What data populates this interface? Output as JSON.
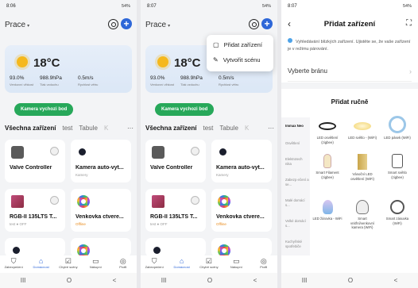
{
  "screen1": {
    "status": {
      "time": "8:06",
      "right": "54%"
    },
    "home_title": "Prace",
    "weather": {
      "temp": "18°C",
      "humidity": "93.0%",
      "humidity_label": "Venkovní vlhkost",
      "pressure": "988.9hPa",
      "pressure_label": "Tlak vzduchu",
      "wind": "0.5m/s",
      "wind_label": "Rychlost větru"
    },
    "camera_button": "Kamera vychozi bod",
    "tabs": [
      "Všechna zařízení",
      "test",
      "Tabule",
      "K"
    ],
    "more": "···",
    "devices": [
      {
        "name": "Valve Controller",
        "sub": ""
      },
      {
        "name": "Kamera auto-vyt...",
        "sub": "Kamery"
      },
      {
        "name": "RGB-II 135LTS T...",
        "sub": "test",
        "sub2": "OFF"
      },
      {
        "name": "Venkovka ctvere...",
        "sub": "Offline"
      }
    ],
    "nav": [
      "Zabezpečení",
      "Domácnost",
      "Chytré scény",
      "Nákupní",
      "Profil"
    ]
  },
  "screen2": {
    "status": {
      "time": "8:07",
      "right": "54%"
    },
    "home_title": "Prace",
    "popup": {
      "add": "Přidat zařízení",
      "scene": "Vytvořit scénu"
    },
    "weather": {
      "temp": "18°C",
      "humidity": "93.0%",
      "humidity_label": "Venkovní vlhkost",
      "pressure": "988.9hPa",
      "pressure_label": "Tlak vzduchu",
      "wind": "0.5m/s",
      "wind_label": "Rychlost větru"
    },
    "camera_button": "Kamera vychozi bod",
    "tabs": [
      "Všechna zařízení",
      "test",
      "Tabule",
      "K"
    ],
    "more": "···",
    "devices": [
      {
        "name": "Valve Controller",
        "sub": ""
      },
      {
        "name": "Kamera auto-vyt...",
        "sub": "Kamery"
      },
      {
        "name": "RGB-II 135LTS T...",
        "sub": "test",
        "sub2": "OFF"
      },
      {
        "name": "Venkovka ctvere...",
        "sub": "Offline"
      }
    ],
    "nav": [
      "Zabezpečení",
      "Domácnost",
      "Chytré scény",
      "Nákupní",
      "Profil"
    ]
  },
  "screen3": {
    "status": {
      "time": "8:07",
      "right": "54%"
    },
    "title": "Přidat zařízení",
    "info": "Vyhledávání blízkých zařízení. Ujistěte se, že vaše zařízení je v režimu párování.",
    "gateway": "Vyberte bránu",
    "manual_title": "Přidat ručně",
    "categories": [
      "Immax Neo",
      "Osvětlení",
      "Elektrotech nika",
      "Zabezp ečení a se...",
      "Malé domácí s...",
      "Velké domácí s...",
      "Kuchyňské spotřebiče"
    ],
    "products": [
      "LED osvětlení (zigbee)",
      "LED světlo - (WiFi)",
      "LED pásek (WiFi)",
      "Smart Filament (zigbee)",
      "Vánoční LED osvětlení (WiFi)",
      "Smart světlo (zigbee)",
      "LED žárovka - WiFi",
      "Smart vnitřní/venkovní kamera (WiFi)",
      "Smart zásuvka (WiFi)"
    ]
  },
  "sys_nav": [
    "III",
    "O",
    "<"
  ]
}
